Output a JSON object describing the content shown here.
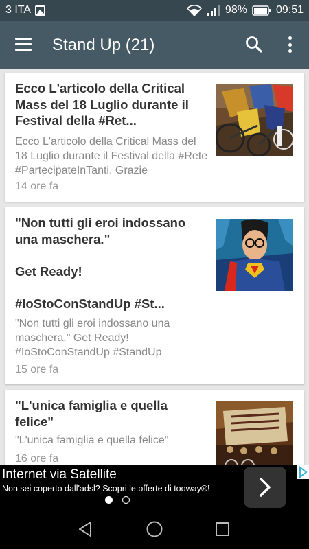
{
  "status_bar": {
    "carrier": "3 ITA",
    "battery": "98%",
    "time": "09:51"
  },
  "app_bar": {
    "title": "Stand Up (21)"
  },
  "articles": [
    {
      "title": " Ecco L'articolo della Critical Mass del 18 Luglio durante il Festival della #Ret...",
      "summary": "Ecco L'articolo della Critical Mass del 18 Luglio durante il Festival della #Rete #PartecipateInTanti. Grazie",
      "time": "14 ore fa",
      "thumbnail": "cyclists-photo"
    },
    {
      "title": " \"Non tutti gli eroi indossano una maschera.\"\n\nGet Ready!\n\n#IoStoConStandUp #St...",
      "summary": "\"Non tutti gli eroi indossano una maschera.\" Get Ready! #IoStoConStandUp #StandUp",
      "time": "15 ore fa",
      "thumbnail": "superhero-comic-image"
    },
    {
      "title": " \"L'unica famiglia e quella felice\"",
      "summary": "\"L'unica famiglia e quella felice\"",
      "time": "16 ore fa",
      "thumbnail": "protest-banner-photo"
    }
  ],
  "ad": {
    "headline": "Internet via Satellite",
    "subtext": "Non sei coperto dall'adsl? Scopri le offerte di tooway®!"
  },
  "colors": {
    "status_bar": "#37474f",
    "app_bar": "#455a64",
    "background": "#e6e6e6"
  }
}
